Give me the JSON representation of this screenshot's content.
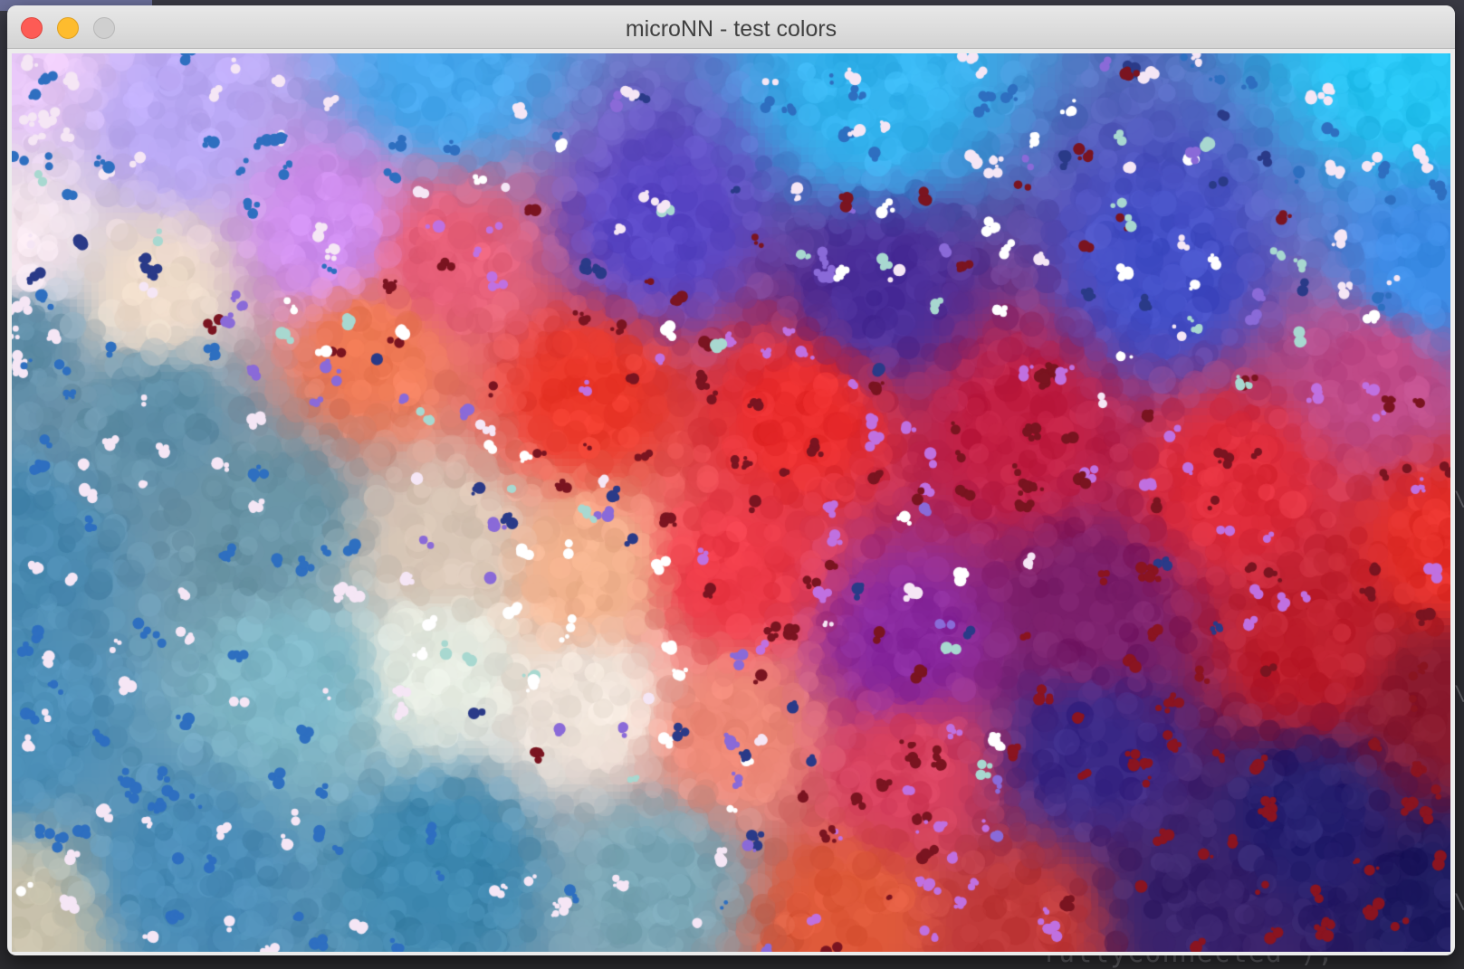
{
  "window": {
    "title": "microNN - test colors",
    "buttons": {
      "close": {
        "icon": "close-icon",
        "color": "#fd5b55"
      },
      "minimize": {
        "icon": "minimize-icon",
        "color": "#febc2e"
      },
      "zoom": {
        "icon": "zoom-icon",
        "color": "#cfcfcf"
      }
    }
  },
  "desktop": {
    "background_code_text": "fullyConnected );",
    "edge_marks": [
      "\\",
      "\\",
      "\\"
    ]
  },
  "canvas": {
    "description_colors": {
      "sky": "#2fc3f0",
      "violet": "#5a3fb8",
      "red": "#ee3030",
      "navy": "#241f6a",
      "cream": "#efe9da",
      "teal": "#3f8cb0"
    }
  }
}
